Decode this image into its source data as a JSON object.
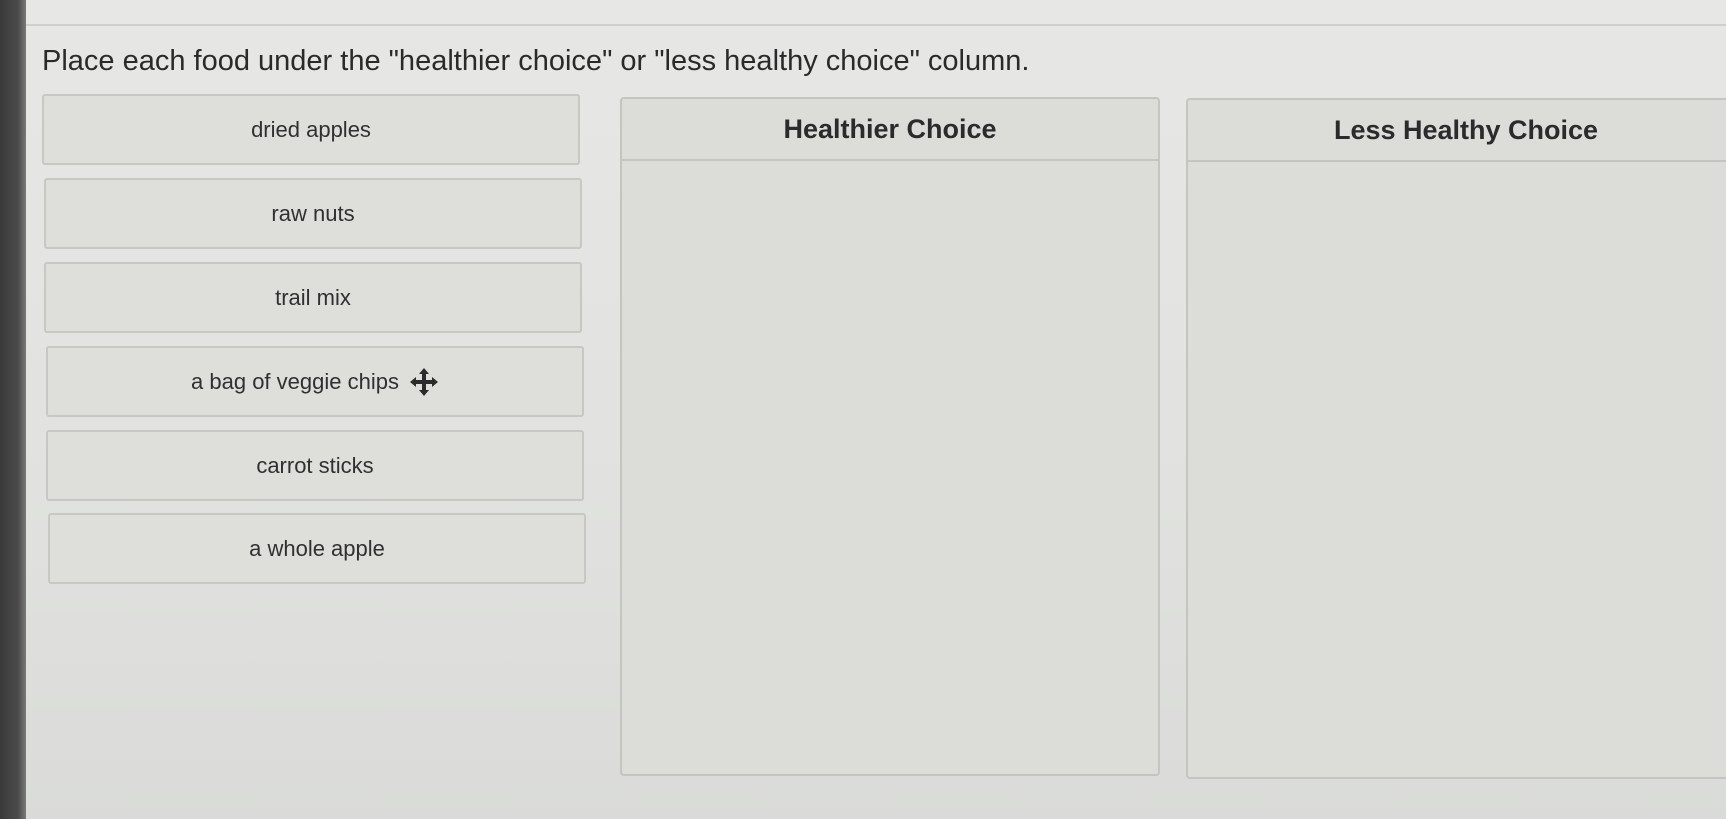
{
  "instruction": "Place each food under the \"healthier choice\" or \"less healthy choice\" column.",
  "food_items": [
    {
      "label": "dried apples"
    },
    {
      "label": "raw nuts"
    },
    {
      "label": "trail mix"
    },
    {
      "label": "a bag of veggie chips",
      "icon": "move-icon"
    },
    {
      "label": "carrot sticks"
    },
    {
      "label": "a whole apple"
    }
  ],
  "columns": [
    {
      "title": "Healthier Choice",
      "items": []
    },
    {
      "title": "Less Healthy Choice",
      "items": []
    }
  ]
}
